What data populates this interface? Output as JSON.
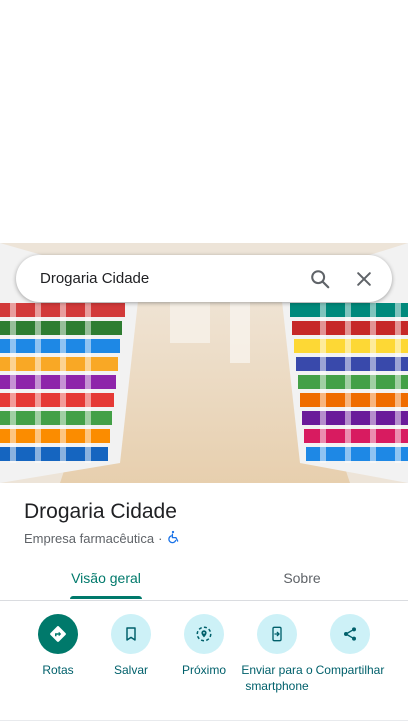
{
  "search": {
    "query": "Drogaria Cidade"
  },
  "place": {
    "name": "Drogaria Cidade",
    "category": "Empresa farmacêutica",
    "separator": "·"
  },
  "tabs": [
    {
      "label": "Visão geral",
      "active": true
    },
    {
      "label": "Sobre",
      "active": false
    }
  ],
  "actions": [
    {
      "label": "Rotas",
      "icon": "directions-icon"
    },
    {
      "label": "Salvar",
      "icon": "bookmark-icon"
    },
    {
      "label": "Próximo",
      "icon": "nearby-icon"
    },
    {
      "label": "Enviar para o smartphone",
      "icon": "send-to-phone-icon"
    },
    {
      "label": "Compartilhar",
      "icon": "share-icon"
    }
  ],
  "colors": {
    "accent": "#00796b",
    "icon_bg": "#cdf1f7",
    "icon_fg": "#00606b"
  }
}
